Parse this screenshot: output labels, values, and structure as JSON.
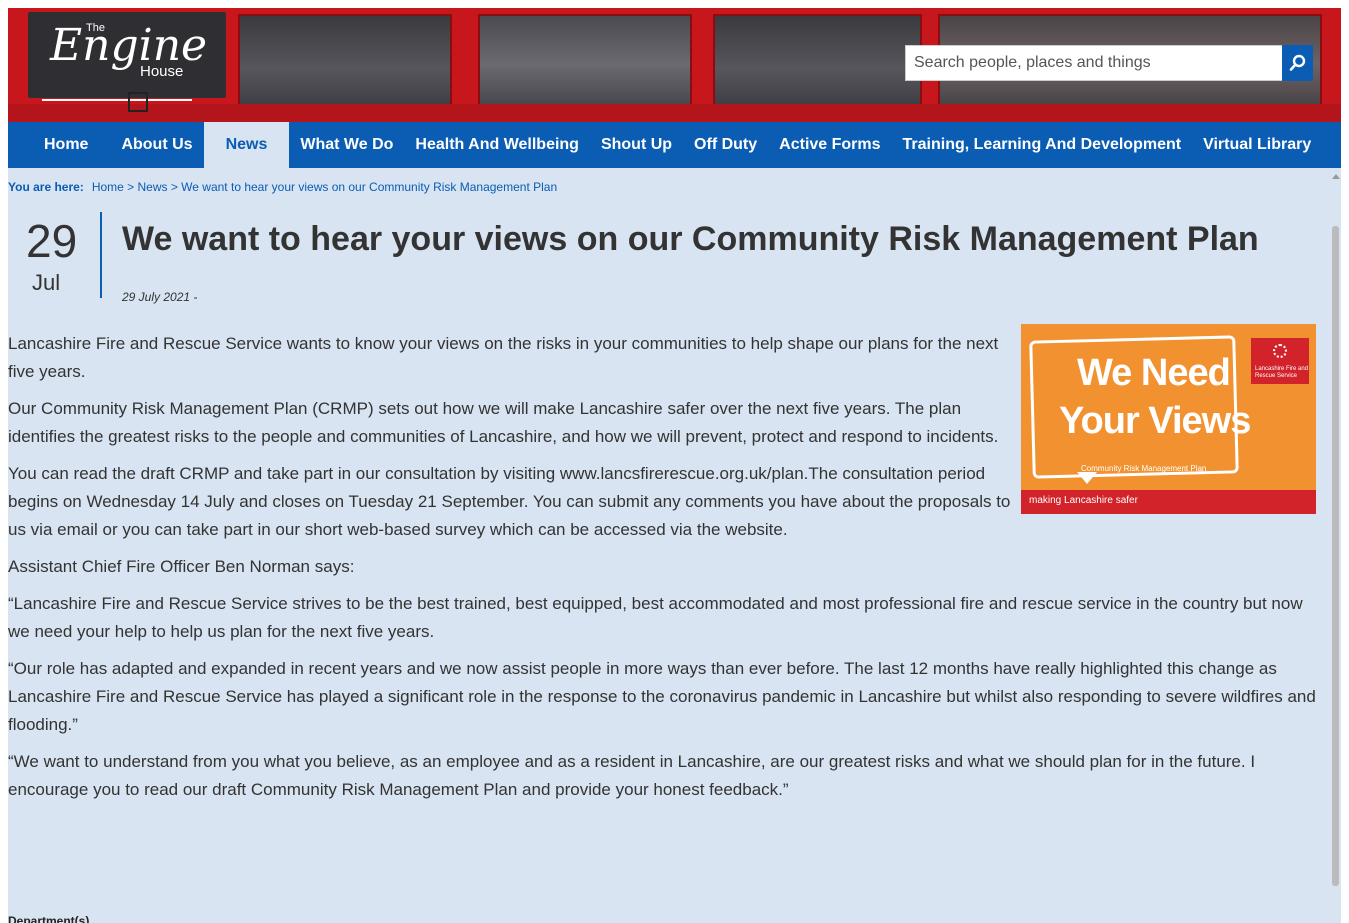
{
  "header": {
    "logo_the": "The",
    "logo_engine": "Engine",
    "logo_house": "House",
    "search_placeholder": "Search people, places and things",
    "search_icon": "magnifier-icon"
  },
  "nav": {
    "items": [
      "Home",
      "About Us",
      "News",
      "What We Do",
      "Health And Wellbeing",
      "Shout Up",
      "Off Duty",
      "Active Forms",
      "Training, Learning And Development",
      "Virtual Library"
    ],
    "active": "News"
  },
  "breadcrumb": {
    "label": "You are here:",
    "path": "Home > News > We want to hear your views on our Community Risk Management Plan"
  },
  "article": {
    "day": "29",
    "month": "Jul",
    "title": "We want to hear your views on our Community Risk Management Plan",
    "date_line": "29 July 2021 -",
    "p1": "Lancashire Fire and Rescue Service wants to know your views on the risks in your communities to help shape our plans for the next five years.",
    "p2": "Our Community Risk Management Plan (CRMP) sets out how we will make Lancashire safer over the next five years. The plan identifies the greatest risks to the people and communities of Lancashire, and how we will prevent, protect and respond to incidents.",
    "p3_a": "You can read the draft CRMP and take part in our consultation by visiting ",
    "p3_link": "www.lancsfirerescue.org.uk/plan",
    "p3_b": ".The consultation period begins on Wednesday 14 July and closes on Tuesday 21 September. You can submit any comments you have about the proposals to us via ",
    "p3_email": "email",
    "p3_c": " or you can take part in our short web-based survey which can be accessed via the website.",
    "p4": "Assistant Chief Fire Officer Ben Norman says:",
    "p5": "“Lancashire Fire and Rescue Service strives to be the best trained, best equipped, best accommodated and most professional fire and rescue service in the country but now we need your help to help us plan for the next five years.",
    "p6": "“Our role has adapted and expanded in recent years and we now assist people in more ways than ever before. The last 12 months have really highlighted this change as Lancashire Fire and Rescue Service has played a significant role in the response to the coronavirus pandemic in Lancashire but whilst also responding to severe wildfires and flooding.”",
    "p7": "“We want to understand from you what you believe, as an employee and as a resident in Lancashire, are our greatest risks and what we should plan for in the future. I encourage you to read our draft Community Risk Management Plan and provide your honest feedback.”",
    "dept_label": "Department(s)"
  },
  "promo": {
    "line1": "We Need",
    "line2": "Your Views",
    "caption": "Community Risk Management Plan",
    "strip": "making Lancashire safer",
    "badge": "Lancashire Fire and Rescue Service"
  },
  "colors": {
    "header_red": "#c8171c",
    "nav_blue": "#0b5cb3",
    "content_bg": "#d8e4f2",
    "promo_orange": "#f2912f"
  }
}
